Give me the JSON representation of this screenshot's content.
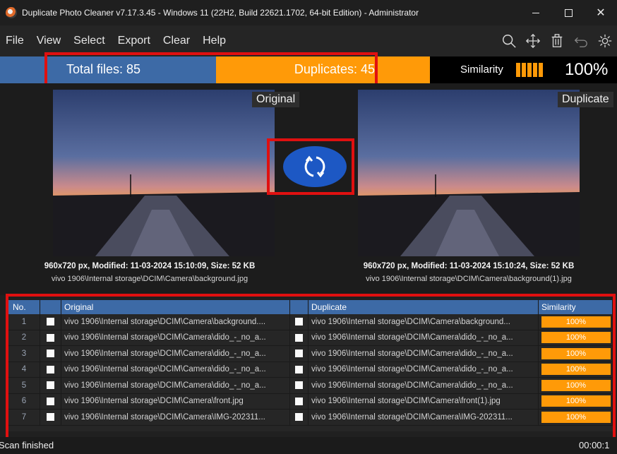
{
  "titlebar": {
    "title": "Duplicate Photo Cleaner v7.17.3.45 - Windows 11 (22H2, Build 22621.1702, 64-bit Edition) - Administrator",
    "close": "✕"
  },
  "menu": [
    "File",
    "View",
    "Select",
    "Export",
    "Clear",
    "Help"
  ],
  "toolbar_icons": [
    "search-icon",
    "move-icon",
    "trash-icon",
    "undo-icon",
    "settings-icon"
  ],
  "stats": {
    "total": "Total files: 85",
    "duplicates": "Duplicates: 45",
    "similarity_label": "Similarity",
    "similarity_value": "100%",
    "similarity_bars": 5
  },
  "colors": {
    "accent_blue": "#3d6aa6",
    "accent_orange": "#ff9a08",
    "highlight_red": "#e01010",
    "swap_button": "#1d58c4"
  },
  "preview": {
    "original": {
      "tag": "Original",
      "info": "960x720 px, Modified: 11-03-2024 15:10:09, Size: 52 KB",
      "path": "vivo 1906\\Internal storage\\DCIM\\Camera\\background.jpg"
    },
    "duplicate": {
      "tag": "Duplicate",
      "info": "960x720 px, Modified: 11-03-2024 15:10:24, Size: 52 KB",
      "path": "vivo 1906\\Internal storage\\DCIM\\Camera\\background(1).jpg"
    },
    "swap_icon": "swap-icon"
  },
  "table": {
    "headers": {
      "no": "No.",
      "original": "Original",
      "duplicate": "Duplicate",
      "similarity": "Similarity"
    },
    "rows": [
      {
        "no": "1",
        "original": "vivo 1906\\Internal storage\\DCIM\\Camera\\background....",
        "duplicate": "vivo 1906\\Internal storage\\DCIM\\Camera\\background...",
        "similarity": "100%"
      },
      {
        "no": "2",
        "original": "vivo 1906\\Internal storage\\DCIM\\Camera\\dido_-_no_a...",
        "duplicate": "vivo 1906\\Internal storage\\DCIM\\Camera\\dido_-_no_a...",
        "similarity": "100%"
      },
      {
        "no": "3",
        "original": "vivo 1906\\Internal storage\\DCIM\\Camera\\dido_-_no_a...",
        "duplicate": "vivo 1906\\Internal storage\\DCIM\\Camera\\dido_-_no_a...",
        "similarity": "100%"
      },
      {
        "no": "4",
        "original": "vivo 1906\\Internal storage\\DCIM\\Camera\\dido_-_no_a...",
        "duplicate": "vivo 1906\\Internal storage\\DCIM\\Camera\\dido_-_no_a...",
        "similarity": "100%"
      },
      {
        "no": "5",
        "original": "vivo 1906\\Internal storage\\DCIM\\Camera\\dido_-_no_a...",
        "duplicate": "vivo 1906\\Internal storage\\DCIM\\Camera\\dido_-_no_a...",
        "similarity": "100%"
      },
      {
        "no": "6",
        "original": "vivo 1906\\Internal storage\\DCIM\\Camera\\front.jpg",
        "duplicate": "vivo 1906\\Internal storage\\DCIM\\Camera\\front(1).jpg",
        "similarity": "100%"
      },
      {
        "no": "7",
        "original": "vivo 1906\\Internal storage\\DCIM\\Camera\\IMG-202311...",
        "duplicate": "vivo 1906\\Internal storage\\DCIM\\Camera\\IMG-202311...",
        "similarity": "100%"
      }
    ]
  },
  "status": {
    "left": "Scan finished",
    "right": "00:00:1"
  }
}
